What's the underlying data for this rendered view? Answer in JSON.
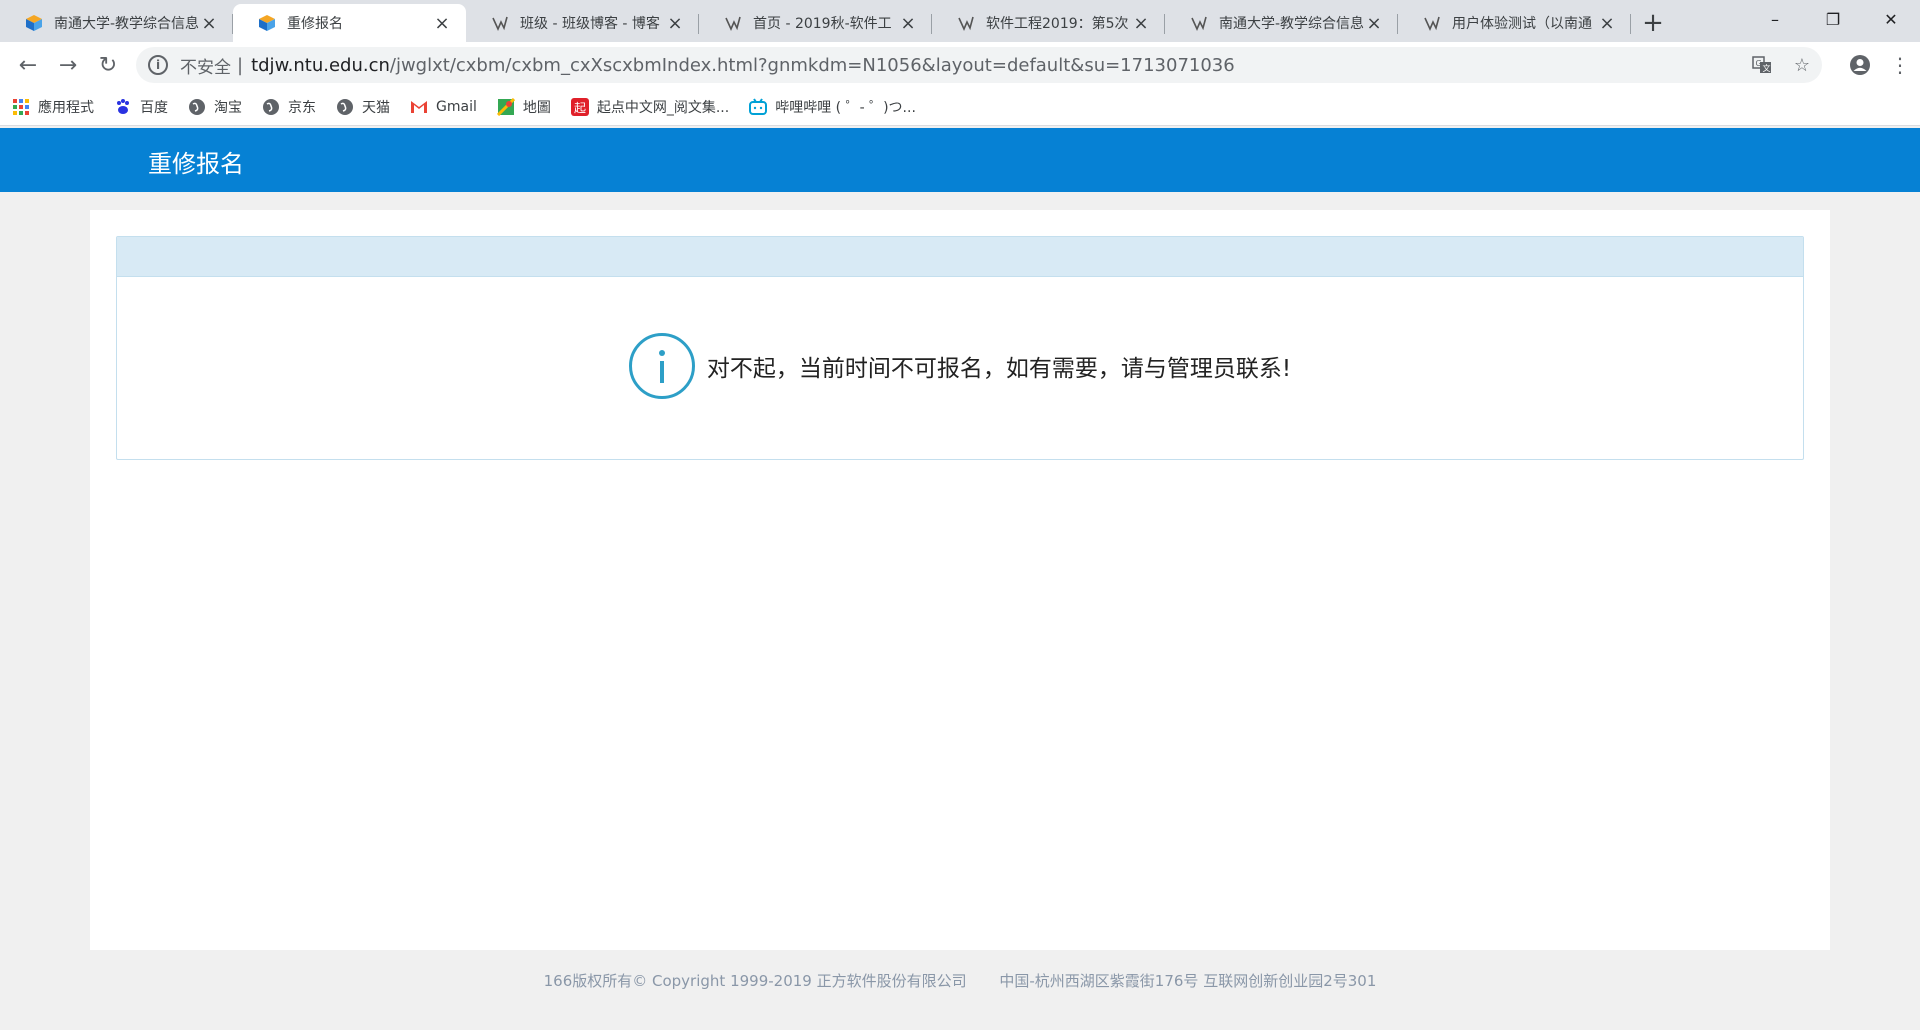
{
  "browser": {
    "tabs": [
      {
        "title": "南通大学-教学综合信息",
        "icon": "cube-icon",
        "active": false
      },
      {
        "title": "重修报名",
        "icon": "cube-icon",
        "active": true
      },
      {
        "title": "班级 - 班级博客 - 博客",
        "icon": "cnblogs-icon",
        "active": false
      },
      {
        "title": "首页 - 2019秋-软件工",
        "icon": "cnblogs-icon",
        "active": false
      },
      {
        "title": "软件工程2019：第5次",
        "icon": "cnblogs-icon",
        "active": false
      },
      {
        "title": "南通大学-教学综合信息",
        "icon": "cnblogs-icon",
        "active": false
      },
      {
        "title": "用户体验测试（以南通",
        "icon": "cnblogs-icon",
        "active": false
      }
    ],
    "new_tab": "+",
    "window_controls": {
      "minimize": "–",
      "restore": "❐",
      "close": "✕"
    },
    "nav": {
      "back": "←",
      "forward": "→",
      "reload": "↻"
    },
    "address": {
      "security_label": "不安全",
      "separator": "|",
      "host": "tdjw.ntu.edu.cn",
      "path": "/jwglxt/cxbm/cxbm_cxXscxbmIndex.html?gnmkdm=N1056&layout=default&su=1713071036"
    },
    "bookmarks": [
      {
        "label": "應用程式",
        "icon": "apps-grid-icon"
      },
      {
        "label": "百度",
        "icon": "baidu-paw-icon"
      },
      {
        "label": "淘宝",
        "icon": "globe-icon"
      },
      {
        "label": "京东",
        "icon": "globe-icon"
      },
      {
        "label": "天猫",
        "icon": "globe-icon"
      },
      {
        "label": "Gmail",
        "icon": "gmail-icon"
      },
      {
        "label": "地圖",
        "icon": "maps-pin-icon"
      },
      {
        "label": "起点中文网_阅文集...",
        "icon": "qidian-icon"
      },
      {
        "label": "哔哩哔哩 ( ゜- ゜)つ...",
        "icon": "bilibili-tv-icon"
      }
    ]
  },
  "page": {
    "header_title": "重修报名",
    "notice": "对不起，当前时间不可报名，如有需要，请与管理员联系!",
    "footer": {
      "copyright": "166版权所有© Copyright 1999-2019 正方软件股份有限公司",
      "address": "中国-杭州西湖区紫霞街176号 互联网创新创业园2号301"
    }
  },
  "colors": {
    "header_bg": "#0681d4",
    "info_circle": "#2d9fc7",
    "box_head_bg": "#d8eaf5",
    "footer_text": "#8a97a8"
  }
}
